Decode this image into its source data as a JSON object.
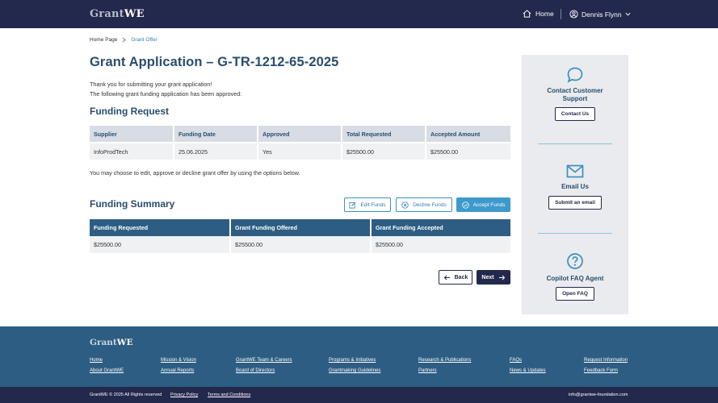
{
  "header": {
    "logo_grant": "Grant",
    "logo_we": "WE",
    "home_label": "Home",
    "user_name": "Dennis Flynn"
  },
  "breadcrumb": {
    "home": "Home Page",
    "current": "Grant Offer"
  },
  "page": {
    "title": "Grant Application – G-TR-1212-65-2025",
    "intro_line1": "Thank you for submitting your grant application!",
    "intro_line2": "The following grant funding application has been approved:"
  },
  "funding_request": {
    "heading": "Funding Request",
    "columns": [
      "Supplier",
      "Funding Date",
      "Approved",
      "Total Requested",
      "Accepted Amount"
    ],
    "rows": [
      [
        "InfoProdTech",
        "25.06.2025",
        "Yes",
        "$25500.00",
        "$25500.00"
      ]
    ],
    "note": "You may choose to edit, approve or decline grant offer by using the options below."
  },
  "funding_summary": {
    "heading": "Funding Summary",
    "edit_label": "Edit Funds",
    "decline_label": "Decline Funds",
    "accept_label": "Accept Funds",
    "columns": [
      "Funding Requested",
      "Grant Funding Offered",
      "Grant Funding Accepted"
    ],
    "rows": [
      [
        "$25500.00",
        "$25500.00",
        "$25500.00"
      ]
    ]
  },
  "nav_buttons": {
    "back": "Back",
    "next": "Next"
  },
  "sidebar": {
    "contact_title_1": "Contact Customer",
    "contact_title_2": "Support",
    "contact_button": "Contact Us",
    "email_title": "Email Us",
    "email_button": "Submit an email",
    "faq_title": "Copilot FAQ Agent",
    "faq_button": "Open FAQ"
  },
  "footer": {
    "logo_grant": "Grant",
    "logo_we": "WE",
    "links": {
      "home": "Home",
      "about": "About GrantWE",
      "mission": "Mission & Vision",
      "annual": "Annual Reports",
      "team": "GrantWE Team & Careers",
      "board": "Board of Directors",
      "programs": "Programs & Initiatives",
      "guidelines": "Grantmaking Guidelines",
      "research": "Research & Publications",
      "partners": "Partners",
      "faqs": "FAQs",
      "news": "News & Updates",
      "request": "Request Information",
      "feedback": "Feedback Form"
    },
    "copyright": "GrantWE © 2025 All Rights reserved",
    "privacy": "Privacy Policy",
    "terms": "Terms and Conditions",
    "email": "info@grantwe-foundation.com"
  },
  "colors": {
    "navy": "#23284d",
    "title_blue": "#2a4d6e",
    "accent_blue": "#3d9acb",
    "footer_blue": "#2d5d82"
  },
  "icons": [
    "home-icon",
    "user-icon",
    "chevron-down-icon",
    "chevron-right-icon",
    "edit-icon",
    "decline-icon",
    "check-circle-icon",
    "arrow-left-icon",
    "arrow-right-icon",
    "chat-bubble-icon",
    "mail-icon",
    "help-icon"
  ]
}
